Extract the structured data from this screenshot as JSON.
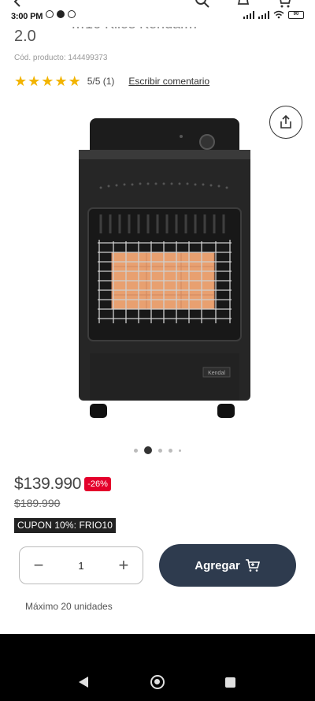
{
  "status_bar": {
    "time": "3:00 PM",
    "battery": "90"
  },
  "product": {
    "title_fragment": "…16 Kilos Kendal…",
    "title_line2": "2.0",
    "sku": "Cód. producto: 144499373",
    "rating": {
      "stars": 5,
      "text": "5/5 (1)"
    },
    "write_review": "Escribir comentario",
    "image_brand": "Kendal",
    "image_count": 5,
    "active_image": 1
  },
  "pricing": {
    "current": "$139.990",
    "discount": "-26%",
    "old": "$189.990",
    "coupon": "CUPON 10%: FRIO10"
  },
  "cart": {
    "minus": "−",
    "quantity": "1",
    "plus": "+",
    "add_label": "Agregar",
    "max_units": "Máximo 20 unidades"
  },
  "colors": {
    "accent": "#2e3b4e",
    "discount": "#e4002b",
    "star": "#f2b400"
  },
  "icons": [
    "back-arrow-icon",
    "search-icon",
    "notification-icon",
    "cart-icon",
    "share-icon",
    "cart-add-icon"
  ]
}
